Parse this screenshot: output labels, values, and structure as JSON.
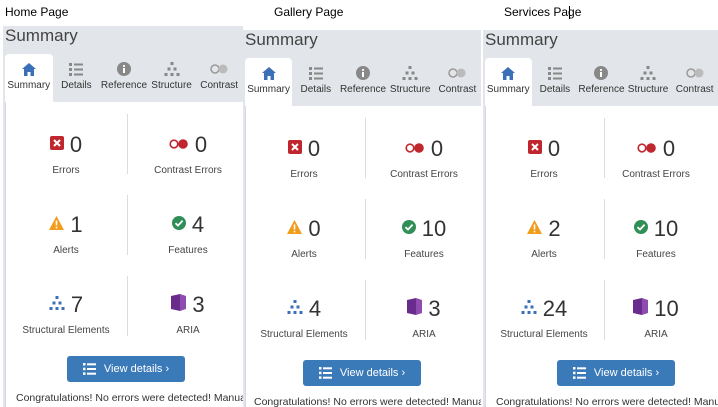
{
  "captions": [
    "Home Page",
    "Gallery Page",
    "Services Page"
  ],
  "panels": [
    {
      "title": "Summary",
      "tabs": [
        "Summary",
        "Details",
        "Reference",
        "Structure",
        "Contrast"
      ],
      "stats": {
        "errors": {
          "value": "0",
          "label": "Errors"
        },
        "contrast": {
          "value": "0",
          "label": "Contrast Errors"
        },
        "alerts": {
          "value": "1",
          "label": "Alerts"
        },
        "features": {
          "value": "4",
          "label": "Features"
        },
        "structural": {
          "value": "7",
          "label": "Structural Elements"
        },
        "aria": {
          "value": "3",
          "label": "ARIA"
        }
      },
      "button": "View details ›",
      "congrats": "Congratulations! No errors were detected! Manual testing is still required."
    },
    {
      "title": "Summary",
      "tabs": [
        "Summary",
        "Details",
        "Reference",
        "Structure",
        "Contrast"
      ],
      "stats": {
        "errors": {
          "value": "0",
          "label": "Errors"
        },
        "contrast": {
          "value": "0",
          "label": "Contrast Errors"
        },
        "alerts": {
          "value": "0",
          "label": "Alerts"
        },
        "features": {
          "value": "10",
          "label": "Features"
        },
        "structural": {
          "value": "4",
          "label": "Structural Elements"
        },
        "aria": {
          "value": "3",
          "label": "ARIA"
        }
      },
      "button": "View details ›",
      "congrats": "Congratulations! No errors were detected! Manual testing is still required."
    },
    {
      "title": "Summary",
      "tabs": [
        "Summary",
        "Details",
        "Reference",
        "Structure",
        "Contrast"
      ],
      "stats": {
        "errors": {
          "value": "0",
          "label": "Errors"
        },
        "contrast": {
          "value": "0",
          "label": "Contrast Errors"
        },
        "alerts": {
          "value": "2",
          "label": "Alerts"
        },
        "features": {
          "value": "10",
          "label": "Features"
        },
        "structural": {
          "value": "24",
          "label": "Structural Elements"
        },
        "aria": {
          "value": "10",
          "label": "ARIA"
        }
      },
      "button": "View details ›",
      "congrats": "Congratulations! No errors were detected! Manual testing is still required."
    }
  ],
  "icons": {
    "tabs": [
      "home-icon",
      "list-icon",
      "info-icon",
      "hierarchy-icon",
      "contrast-icon"
    ],
    "stats": [
      "error-icon",
      "contrast-icon",
      "alert-icon",
      "feature-icon",
      "structure-icon",
      "aria-icon"
    ]
  },
  "colors": {
    "error": "#c0262d",
    "alert": "#f29c1b",
    "feature": "#2f8f57",
    "structure": "#3b6fb8",
    "aria": "#6a2c8c",
    "button": "#3b7ab8"
  }
}
